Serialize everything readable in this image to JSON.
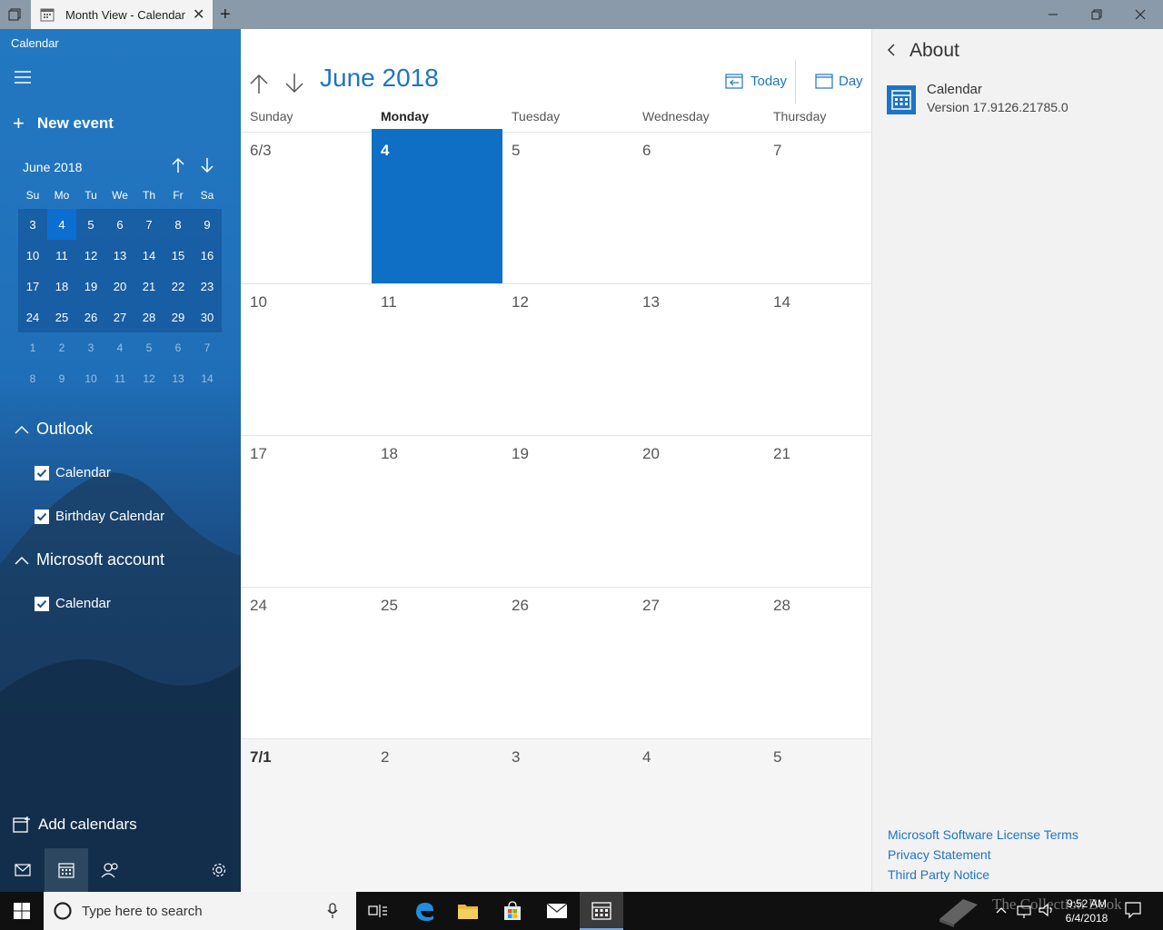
{
  "titlebar": {
    "tab_title": "Month View - Calendar"
  },
  "sidebar": {
    "app_name": "Calendar",
    "new_event_label": "New event",
    "mini_calendar": {
      "title": "June 2018",
      "weekdays": [
        "Su",
        "Mo",
        "Tu",
        "We",
        "Th",
        "Fr",
        "Sa"
      ],
      "weeks": [
        [
          "3",
          "4",
          "5",
          "6",
          "7",
          "8",
          "9"
        ],
        [
          "10",
          "11",
          "12",
          "13",
          "14",
          "15",
          "16"
        ],
        [
          "17",
          "18",
          "19",
          "20",
          "21",
          "22",
          "23"
        ],
        [
          "24",
          "25",
          "26",
          "27",
          "28",
          "29",
          "30"
        ],
        [
          "1",
          "2",
          "3",
          "4",
          "5",
          "6",
          "7"
        ],
        [
          "8",
          "9",
          "10",
          "11",
          "12",
          "13",
          "14"
        ]
      ]
    },
    "groups": [
      {
        "name": "Outlook",
        "calendars": [
          "Calendar",
          "Birthday Calendar"
        ]
      },
      {
        "name": "Microsoft account",
        "calendars": [
          "Calendar"
        ]
      }
    ],
    "add_calendars_label": "Add calendars"
  },
  "main": {
    "month_title": "June 2018",
    "today_label": "Today",
    "day_label": "Day",
    "day_headers": [
      "Sunday",
      "Monday",
      "Tuesday",
      "Wednesday",
      "Thursday"
    ],
    "weeks": [
      [
        "6/3",
        "4",
        "5",
        "6",
        "7"
      ],
      [
        "10",
        "11",
        "12",
        "13",
        "14"
      ],
      [
        "17",
        "18",
        "19",
        "20",
        "21"
      ],
      [
        "24",
        "25",
        "26",
        "27",
        "28"
      ],
      [
        "7/1",
        "2",
        "3",
        "4",
        "5"
      ]
    ]
  },
  "about": {
    "title": "About",
    "app_name": "Calendar",
    "version": "Version 17.9126.21785.0",
    "links": [
      "Microsoft Software License Terms",
      "Privacy Statement",
      "Third Party Notice"
    ]
  },
  "taskbar": {
    "search_placeholder": "Type here to search",
    "time": "9:52 AM",
    "date": "6/4/2018",
    "watermark": "The Collection Book"
  },
  "colors": {
    "accent": "#1e74c4",
    "today_fill": "#0e6fc5",
    "sidebar_top": "#2378c2"
  }
}
